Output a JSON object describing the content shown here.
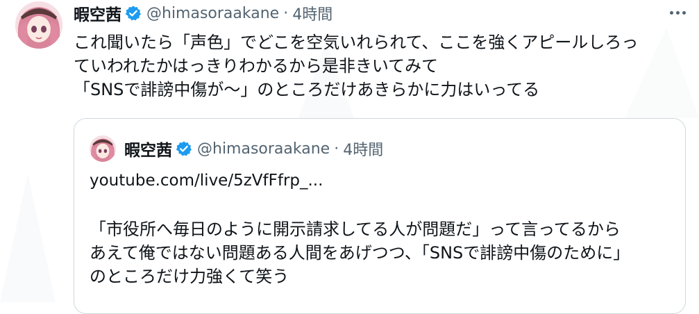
{
  "tweet": {
    "display_name": "暇空茜",
    "handle": "@himasoraakane",
    "separator": "·",
    "time": "4時間",
    "body_lines": [
      "これ聞いたら「声色」でどこを空気いれられて、ここを強くアピールしろっ",
      "ていわれたかはっきりわかるから是非きいてみて",
      "「SNSで誹謗中傷が～」のところだけあきらかに力はいってる"
    ]
  },
  "quote": {
    "display_name": "暇空茜",
    "handle": "@himasoraakane",
    "separator": "·",
    "time": "4時間",
    "link": "youtube.com/live/5zVfFfrp_...",
    "body_lines": [
      "「市役所へ毎日のように開示請求してる人が問題だ」って言ってるから",
      "あえて俺ではない問題ある人間をあげつつ、「SNSで誹謗中傷のために」",
      "のところだけ力強くて笑う"
    ]
  },
  "icons": {
    "verified": "verified-badge-icon",
    "more": "more-options-icon"
  },
  "colors": {
    "text_primary": "#0f1419",
    "text_secondary": "#536471",
    "verified_blue": "#1d9bf0",
    "border": "#cfd9de"
  }
}
